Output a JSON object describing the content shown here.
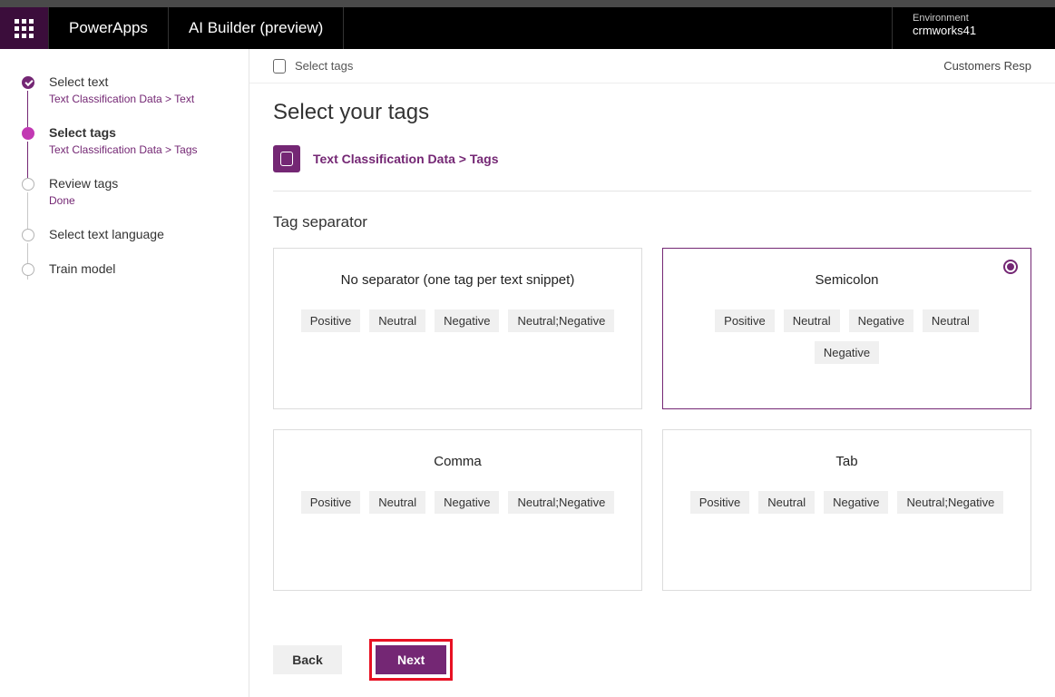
{
  "header": {
    "brand": "PowerApps",
    "area": "AI Builder (preview)",
    "env_label": "Environment",
    "env_value": "crmworks41"
  },
  "breadcrumb": {
    "left": "Select tags",
    "right": "Customers Resp"
  },
  "sidebar": {
    "steps": [
      {
        "title": "Select text",
        "sub": "Text Classification Data > Text"
      },
      {
        "title": "Select tags",
        "sub": "Text Classification Data > Tags"
      },
      {
        "title": "Review tags",
        "sub": "Done"
      },
      {
        "title": "Select text language",
        "sub": ""
      },
      {
        "title": "Train model",
        "sub": ""
      }
    ]
  },
  "page": {
    "title": "Select your tags",
    "field_path": "Text Classification Data > Tags",
    "section_title": "Tag separator",
    "cards": [
      {
        "title": "No separator (one tag per text snippet)",
        "tags": [
          "Positive",
          "Neutral",
          "Negative",
          "Neutral;Negative"
        ],
        "selected": false
      },
      {
        "title": "Semicolon",
        "tags": [
          "Positive",
          "Neutral",
          "Negative",
          "Neutral",
          "Negative"
        ],
        "selected": true
      },
      {
        "title": "Comma",
        "tags": [
          "Positive",
          "Neutral",
          "Negative",
          "Neutral;Negative"
        ],
        "selected": false
      },
      {
        "title": "Tab",
        "tags": [
          "Positive",
          "Neutral",
          "Negative",
          "Neutral;Negative"
        ],
        "selected": false
      }
    ],
    "back": "Back",
    "next": "Next"
  }
}
